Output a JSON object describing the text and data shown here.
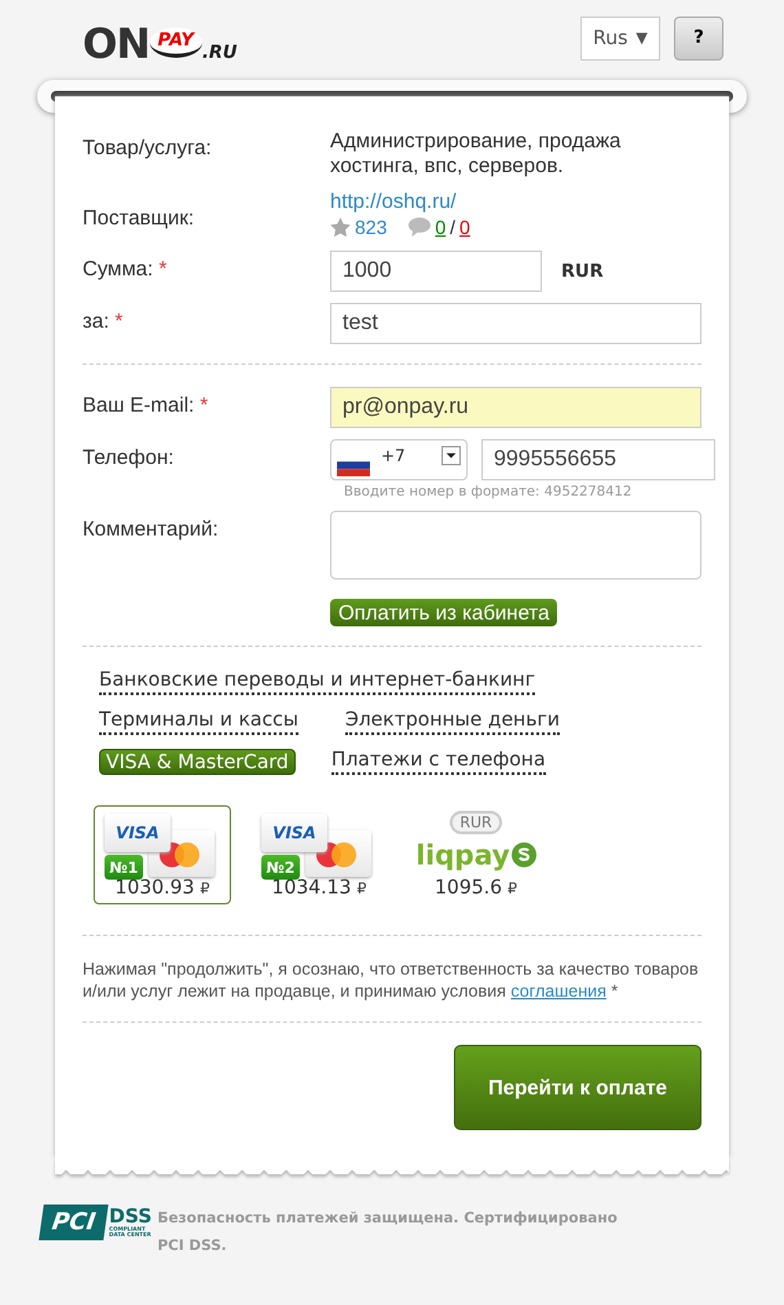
{
  "header": {
    "logo": {
      "on": "ON",
      "pay": "PAY",
      "domain": ".RU"
    },
    "language": {
      "value": "Rus",
      "arrow": "▼"
    },
    "help": "?"
  },
  "order": [
    {
      "kind": "text",
      "label": "Товар/услуга:",
      "value": "Администрирование, продажа хостинга, впс, серверов."
    },
    {
      "kind": "supplier",
      "label": "Поставщик:",
      "link": "http://oshq.ru/",
      "rating": "823",
      "positive": "0",
      "separator": "/",
      "negative": "0"
    }
  ],
  "amount": {
    "label": "Сумма:",
    "required": true,
    "value": "1000",
    "currency": "RUR"
  },
  "purpose": {
    "label": "за:",
    "required": true,
    "value": "test"
  },
  "email": {
    "label": "Ваш E-mail:",
    "required": true,
    "value": "pr@onpay.ru"
  },
  "phone": {
    "label": "Телефон:",
    "required": false,
    "code": "+7",
    "value": "9995556655",
    "hint": "Вводите номер в формате: 4952278412"
  },
  "comment": {
    "label": "Комментарий:",
    "required": false
  },
  "cabinet_button": "Оплатить из кабинета",
  "categories": [
    [
      {
        "label": "Банковские переводы и интернет-банкинг",
        "selected": false
      }
    ],
    [
      {
        "label": "Терминалы и кассы",
        "selected": false
      },
      {
        "label": "Электронные деньги",
        "selected": false
      }
    ],
    [
      {
        "label": "VISA & MasterCard",
        "selected": true
      },
      {
        "label": "Платежи с телефона",
        "selected": false
      }
    ]
  ],
  "options": [
    {
      "kind": "card",
      "brand": "VISA",
      "badge": "№1",
      "price": "1030.93",
      "currency": "₽",
      "selected": true
    },
    {
      "kind": "card",
      "brand": "VISA",
      "badge": "№2",
      "price": "1034.13",
      "currency": "₽",
      "selected": false
    },
    {
      "kind": "liqpay",
      "badge": "RUR",
      "brand": "liqpay",
      "price": "1095.6",
      "currency": "₽",
      "selected": false
    }
  ],
  "agreement": {
    "text": "Нажимая \"продолжить\", я осознаю, что ответственность за качество товаров и/или услуг лежит на продавце, и принимаю условия",
    "link": "соглашения",
    "mark": "*"
  },
  "submit": "Перейти к оплате",
  "footer": {
    "logo": {
      "pci": "PCI",
      "dss": "DSS",
      "line1": "COMPLIANT",
      "line2": "DATA CENTER"
    },
    "text": "Безопасность платежей защищена. Сертифицировано PCI DSS."
  }
}
